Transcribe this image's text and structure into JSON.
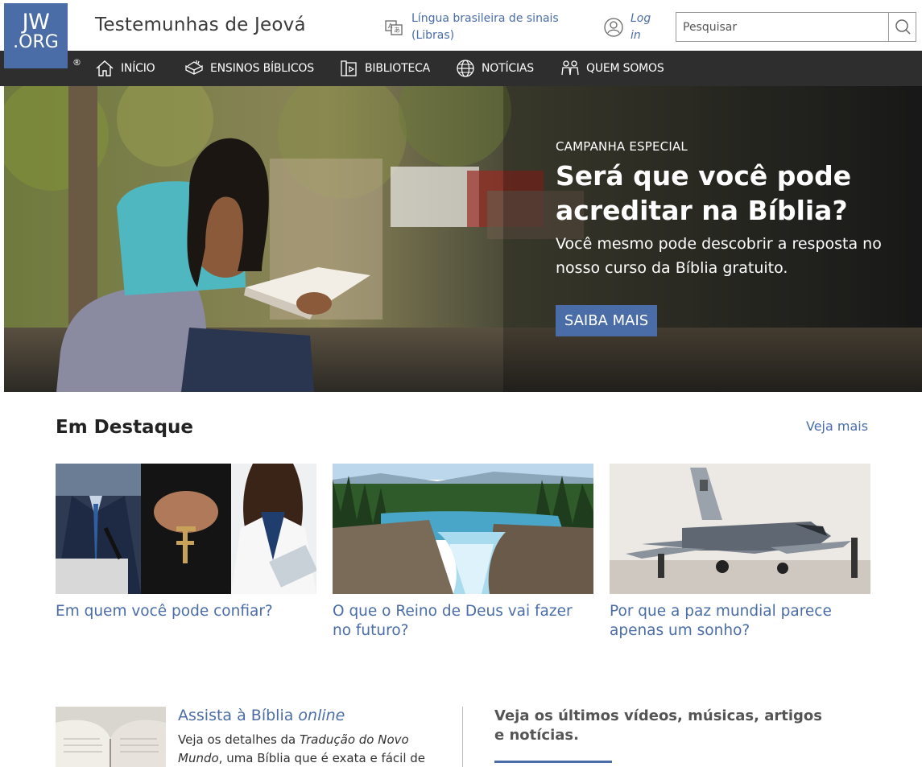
{
  "header": {
    "logo_line1": "JW",
    "logo_line2": ".ORG",
    "registered": "®",
    "site_title": "Testemunhas de Jeová",
    "language_link": "Língua brasileira de sinais (Libras)",
    "login_link": "Log in",
    "search_placeholder": "Pesquisar"
  },
  "nav": {
    "items": [
      {
        "label": "INÍCIO",
        "icon": "home-icon"
      },
      {
        "label": "ENSINOS BÍBLICOS",
        "icon": "open-bible-icon"
      },
      {
        "label": "BIBLIOTECA",
        "icon": "library-icon"
      },
      {
        "label": "NOTÍCIAS",
        "icon": "globe-icon"
      },
      {
        "label": "QUEM SOMOS",
        "icon": "people-icon"
      }
    ]
  },
  "hero": {
    "eyebrow": "CAMPANHA ESPECIAL",
    "title": "Será que você pode acreditar na Bíblia?",
    "subtitle": "Você mesmo pode descobrir a resposta no nosso curso da Bíblia gratuito.",
    "cta": "SAIBA MAIS"
  },
  "featured": {
    "title": "Em Destaque",
    "see_more": "Veja mais",
    "cards": [
      {
        "title": "Em quem você pode confiar?"
      },
      {
        "title": "O que o Reino de Deus vai fazer no futuro?"
      },
      {
        "title": "Por que a paz mundial parece apenas um sonho?"
      }
    ]
  },
  "bottom": {
    "bible_title_prefix": "Assista à Bíblia ",
    "bible_title_em": "online",
    "bible_desc_prefix": "Veja os detalhes da ",
    "bible_desc_em": "Tradução do Novo Mundo",
    "bible_desc_suffix": ", uma Bíblia que é exata e fácil de",
    "latest_title": "Veja os últimos vídeos, músicas, artigos e notícias."
  },
  "colors": {
    "brand_blue": "#4a6da7",
    "nav_bg": "#2e2e2e"
  }
}
